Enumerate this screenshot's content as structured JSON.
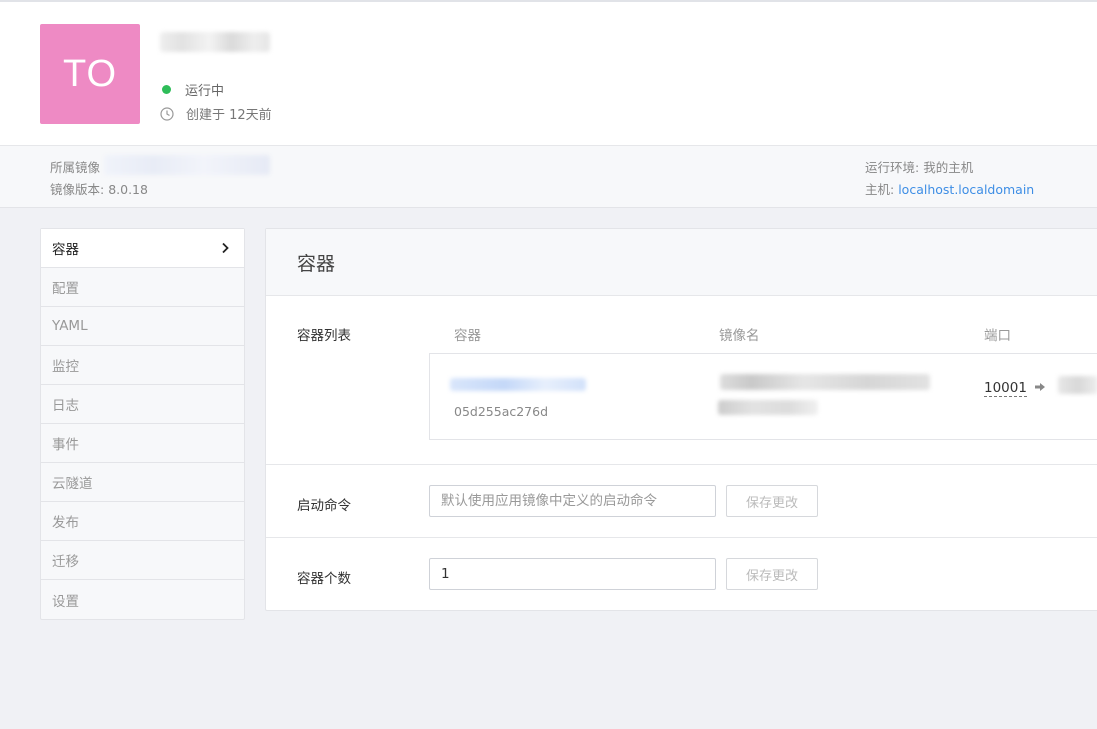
{
  "app": {
    "avatar_initials": "TO",
    "status": "运行中",
    "created": "创建于 12天前",
    "status_color": "#2ebd59",
    "avatar_color": "#ee8ac4"
  },
  "info": {
    "mirror_label": "所属镜像",
    "version_label": "镜像版本:",
    "version_value": "8.0.18",
    "runtime_label": "运行环境:",
    "runtime_value": "我的主机",
    "host_label": "主机:",
    "host_value": "localhost.localdomain"
  },
  "sidebar": {
    "items": [
      {
        "label": "容器"
      },
      {
        "label": "配置"
      },
      {
        "label": "YAML"
      },
      {
        "label": "监控"
      },
      {
        "label": "日志"
      },
      {
        "label": "事件"
      },
      {
        "label": "云隧道"
      },
      {
        "label": "发布"
      },
      {
        "label": "迁移"
      },
      {
        "label": "设置"
      }
    ]
  },
  "panel": {
    "title": "容器",
    "list_label": "容器列表",
    "columns": [
      "容器",
      "镜像名",
      "端口"
    ],
    "container": {
      "id": "05d255ac276d",
      "port": "10001"
    },
    "start_cmd": {
      "label": "启动命令",
      "placeholder": "默认使用应用镜像中定义的启动命令",
      "save": "保存更改"
    },
    "count": {
      "label": "容器个数",
      "value": "1",
      "save": "保存更改"
    }
  }
}
